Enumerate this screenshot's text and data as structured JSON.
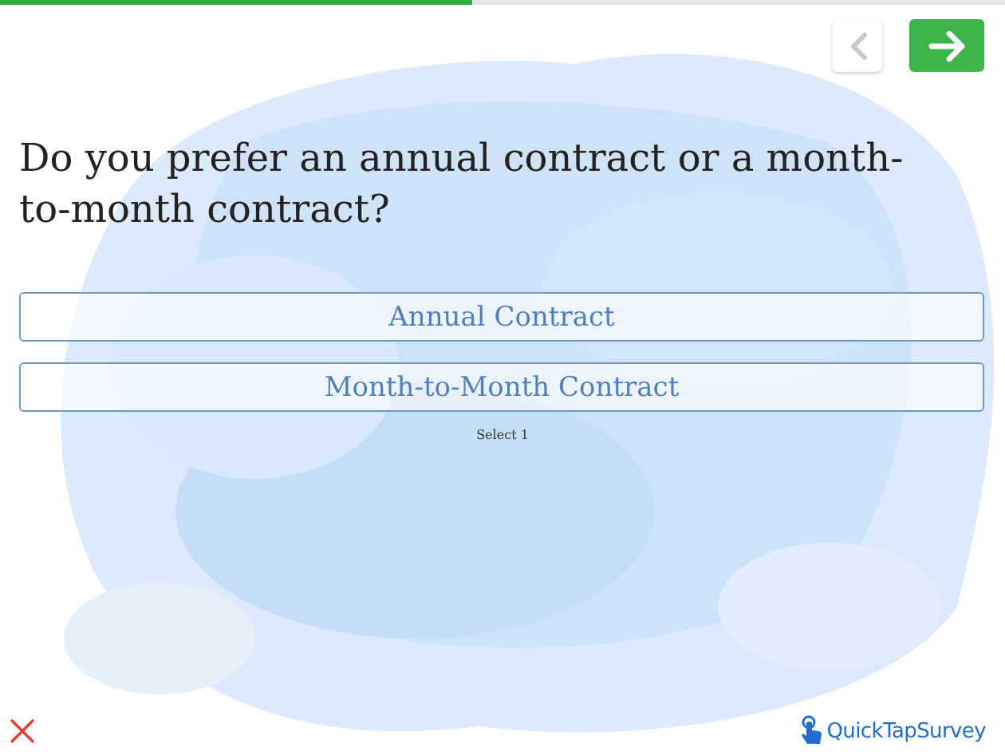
{
  "progress": {
    "level": 0.47
  },
  "nav": {
    "back_disabled": true
  },
  "question": "Do you prefer an annual contract or a month-to-month contract?",
  "options": [
    {
      "label": "Annual Contract",
      "selected": false
    },
    {
      "label": "Month-to-Month Contract",
      "selected": false
    }
  ],
  "hint": "Select 1",
  "brand": "QuickTapSurvey"
}
